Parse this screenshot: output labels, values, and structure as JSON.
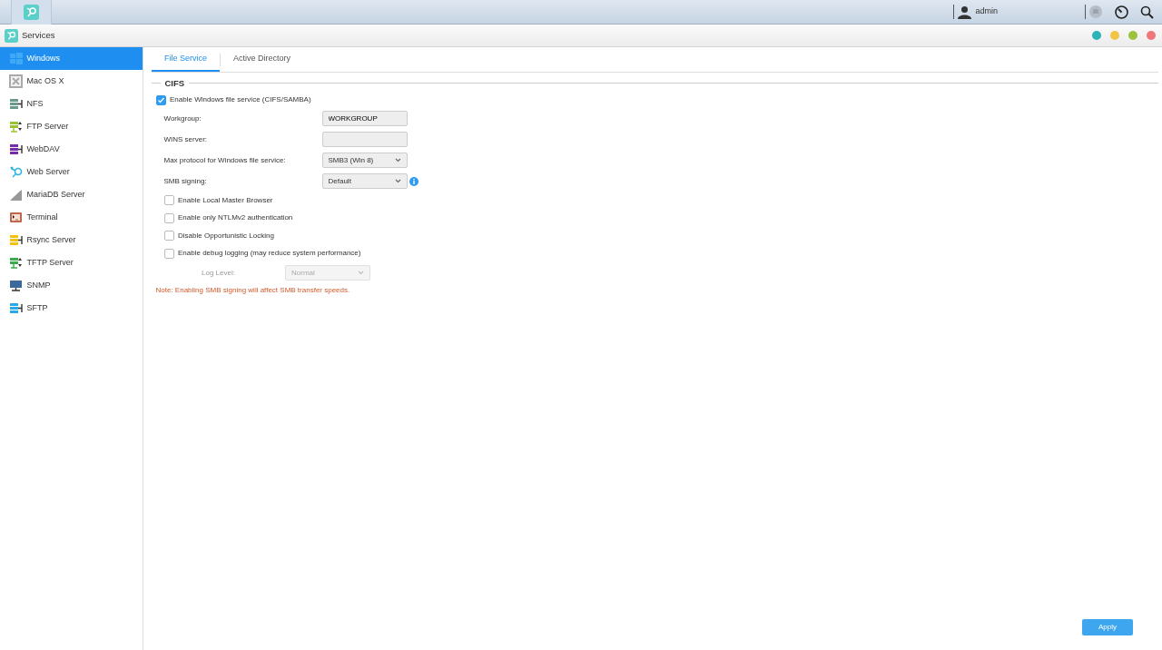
{
  "topbar": {
    "user": "admin"
  },
  "window": {
    "title": "Services",
    "buttons": [
      {
        "color": "#2ab3b8"
      },
      {
        "color": "#f2c443"
      },
      {
        "color": "#9dc23b"
      },
      {
        "color": "#f0767a"
      }
    ]
  },
  "sidebar": {
    "items": [
      {
        "label": "Windows",
        "kind": "windows",
        "color": "#3fa9f5",
        "selected": true
      },
      {
        "label": "Mac OS X",
        "kind": "x",
        "color": "#aaaaaa",
        "selected": false
      },
      {
        "label": "NFS",
        "kind": "rack",
        "color": "#6a9a8a",
        "selected": false
      },
      {
        "label": "FTP Server",
        "kind": "rack2",
        "color": "#9ac235",
        "selected": false
      },
      {
        "label": "WebDAV",
        "kind": "rack",
        "color": "#7a2aa8",
        "selected": false
      },
      {
        "label": "Web Server",
        "kind": "hook",
        "color": "#2ab3e0",
        "selected": false
      },
      {
        "label": "MariaDB Server",
        "kind": "fin",
        "color": "#999999",
        "selected": false
      },
      {
        "label": "Terminal",
        "kind": "terminal",
        "color": "#c0664a",
        "selected": false
      },
      {
        "label": "Rsync Server",
        "kind": "rack",
        "color": "#f5c010",
        "selected": false
      },
      {
        "label": "TFTP Server",
        "kind": "rack2",
        "color": "#3aaa4a",
        "selected": false
      },
      {
        "label": "SNMP",
        "kind": "monitor",
        "color": "#3a6a9a",
        "selected": false
      },
      {
        "label": "SFTP",
        "kind": "rack",
        "color": "#2aa8e8",
        "selected": false
      }
    ]
  },
  "tabs": [
    {
      "label": "File Service",
      "selected": true
    },
    {
      "label": "Active Directory",
      "selected": false
    }
  ],
  "section": "CIFS",
  "enable": {
    "label": "Enable Windows file service (CIFS/SAMBA)",
    "checked": true
  },
  "fields": [
    {
      "label": "Workgroup:",
      "kind": "text",
      "value": "WORKGROUP"
    },
    {
      "label": "WINS server:",
      "kind": "text"
    },
    {
      "label": "Max protocol for Windows file service:",
      "kind": "select",
      "value": "SMB3 (Win 8)"
    },
    {
      "label": "SMB signing:",
      "kind": "select",
      "value": "Default",
      "info": true
    }
  ],
  "options": [
    {
      "label": "Enable Local Master Browser",
      "checked": false
    },
    {
      "label": "Enable only NTLMv2 authentication",
      "checked": false
    },
    {
      "label": "Disable Opportunistic Locking",
      "checked": false
    },
    {
      "label": "Enable debug logging (may reduce system performance)",
      "checked": false
    }
  ],
  "log_level": {
    "label": "Log Level:",
    "value": "Normal",
    "disabled": true
  },
  "note": "Note: Enabling SMB signing will affect SMB transfer speeds.",
  "apply": "Apply"
}
